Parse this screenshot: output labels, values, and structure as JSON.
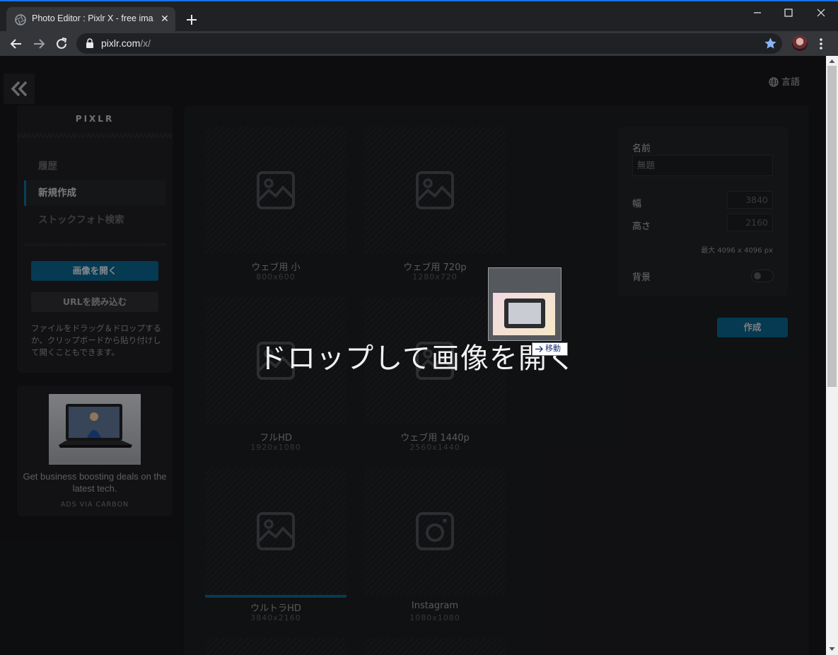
{
  "browser": {
    "tab_title": "Photo Editor : Pixlr X - free image editing online",
    "tab_close": "✕",
    "url_host": "pixlr.com",
    "url_path": "/x/"
  },
  "header": {
    "language_label": "言語"
  },
  "sidebar": {
    "brand": "PIXLR",
    "items": [
      {
        "label": "履歴",
        "active": false
      },
      {
        "label": "新規作成",
        "active": true
      },
      {
        "label": "ストックフォト検索",
        "active": false
      }
    ],
    "open_image_button": "画像を開く",
    "load_url_button": "URLを読み込む",
    "note": "ファイルをドラッグ＆ドロップするか、クリップボードから貼り付けして開くこともできます。"
  },
  "ad": {
    "text": "Get business boosting deals on the latest tech.",
    "via": "ADS VIA CARBON"
  },
  "presets": [
    {
      "label": "ウェブ用 小",
      "size": "800x600",
      "icon": "image-icon",
      "selected": false
    },
    {
      "label": "ウェブ用 720p",
      "size": "1280x720",
      "icon": "image-icon",
      "selected": false
    },
    {
      "label": "フルHD",
      "size": "1920x1080",
      "icon": "image-icon",
      "selected": false
    },
    {
      "label": "ウェブ用 1440p",
      "size": "2560x1440",
      "icon": "image-icon",
      "selected": false
    },
    {
      "label": "ウルトラHD",
      "size": "3840x2160",
      "icon": "image-icon",
      "selected": true
    },
    {
      "label": "Instagram",
      "size": "1080x1080",
      "icon": "instagram-icon",
      "selected": false
    }
  ],
  "settings": {
    "name_label": "名前",
    "name_placeholder": "無題",
    "width_label": "幅",
    "width_value": "3840",
    "height_label": "高さ",
    "height_value": "2160",
    "max_note": "最大 4096 x 4096 px",
    "background_label": "背景",
    "create_button": "作成"
  },
  "drop_overlay": {
    "message": "ドロップして画像を開く"
  },
  "drag": {
    "tooltip": "移動"
  },
  "colors": {
    "accent": "#0b5e85",
    "page_bg": "#151619",
    "browser_accent": "#1a73e8"
  }
}
